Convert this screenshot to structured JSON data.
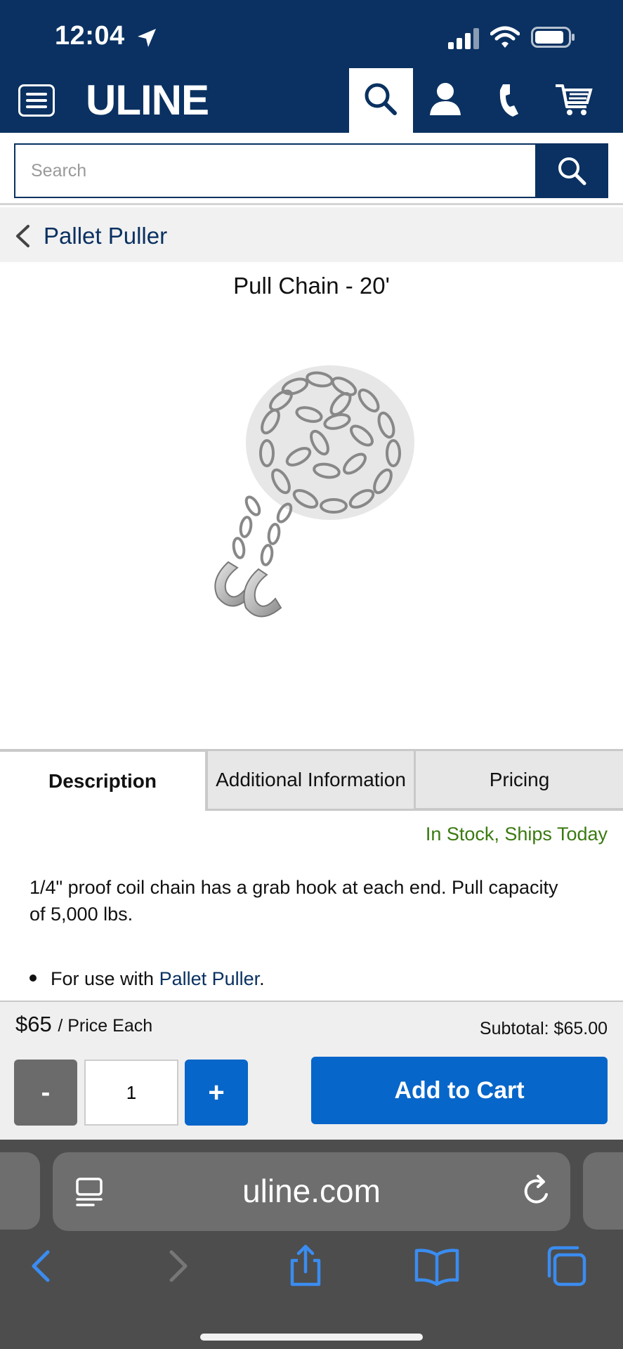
{
  "status_bar": {
    "time": "12:04",
    "icons": [
      "location-arrow-icon",
      "signal-icon",
      "wifi-icon",
      "battery-icon"
    ]
  },
  "header": {
    "logo": "ULINE",
    "icons": [
      "menu-icon",
      "search-icon",
      "account-icon",
      "phone-icon",
      "cart-icon"
    ]
  },
  "search": {
    "placeholder": "Search"
  },
  "breadcrumb": {
    "label": "Pallet Puller"
  },
  "product": {
    "title": "Pull Chain - 20'",
    "image": "chain-with-hooks-image"
  },
  "tabs": [
    {
      "label": "Description",
      "active": true
    },
    {
      "label": "Additional Information",
      "active": false
    },
    {
      "label": "Pricing",
      "active": false
    }
  ],
  "stock": {
    "text": "In Stock, Ships Today",
    "color": "#3a7a10"
  },
  "description": {
    "text": "1/4\" proof coil chain has a grab hook at each end. Pull capacity of 5,000 lbs.",
    "bullet_prefix": "For use with ",
    "bullet_link": "Pallet Puller",
    "bullet_suffix": "."
  },
  "cart": {
    "price": "$65",
    "price_unit": "/ Price Each",
    "subtotal": "Subtotal: $65.00",
    "minus_label": "-",
    "quantity": "1",
    "plus_label": "+",
    "add_label": "Add to Cart"
  },
  "safari": {
    "url": "uline.com",
    "icons": [
      "reader-icon",
      "reload-icon",
      "back-icon",
      "forward-icon",
      "share-icon",
      "bookmarks-icon",
      "tabs-icon"
    ]
  },
  "colors": {
    "brand": "#0a3161",
    "button": "#0766c9",
    "minus_button": "#6b6b6b"
  }
}
